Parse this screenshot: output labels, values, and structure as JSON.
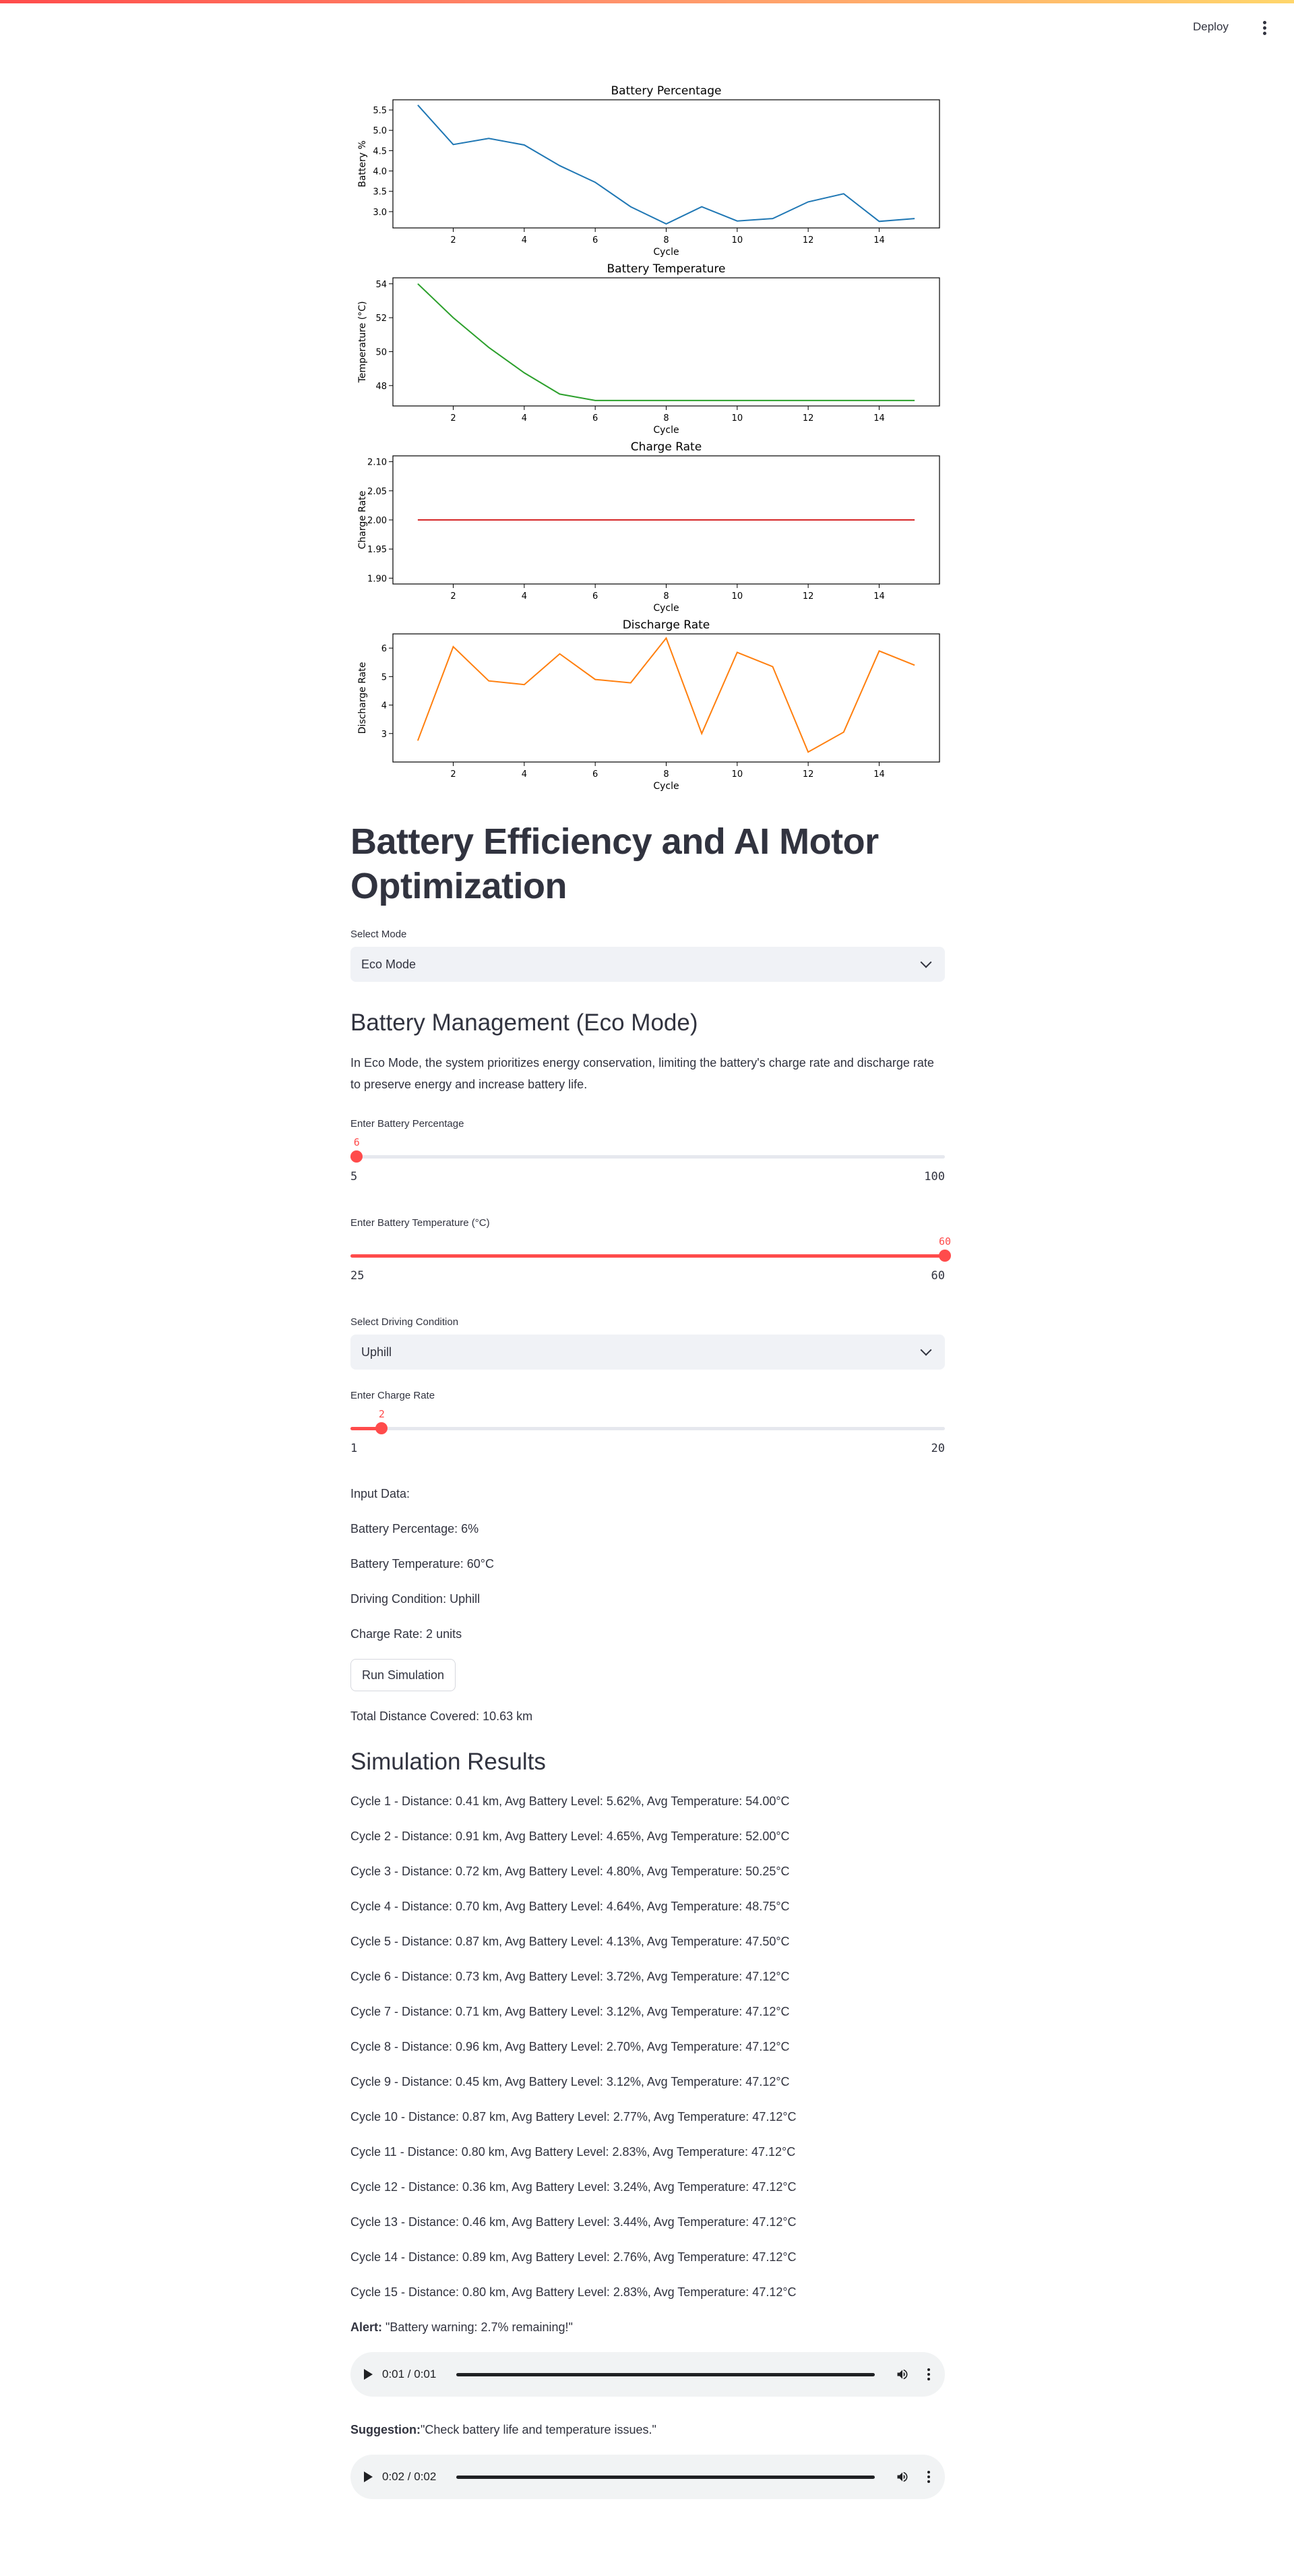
{
  "header": {
    "deploy_label": "Deploy"
  },
  "chart_data": [
    {
      "type": "line",
      "title": "Battery Percentage",
      "xlabel": "Cycle",
      "ylabel": "Battery %",
      "x": [
        1,
        2,
        3,
        4,
        5,
        6,
        7,
        8,
        9,
        10,
        11,
        12,
        13,
        14,
        15
      ],
      "values": [
        5.62,
        4.65,
        4.8,
        4.64,
        4.13,
        3.72,
        3.12,
        2.7,
        3.12,
        2.77,
        2.83,
        3.24,
        3.44,
        2.76,
        2.83
      ],
      "ylim": [
        2.6,
        5.75
      ],
      "yticks": [
        "3.0",
        "3.5",
        "4.0",
        "4.5",
        "5.0",
        "5.5"
      ],
      "xticks": [
        "2",
        "4",
        "6",
        "8",
        "10",
        "12",
        "14"
      ],
      "color": "#1f77b4"
    },
    {
      "type": "line",
      "title": "Battery Temperature",
      "xlabel": "Cycle",
      "ylabel": "Temperature (°C)",
      "x": [
        1,
        2,
        3,
        4,
        5,
        6,
        7,
        8,
        9,
        10,
        11,
        12,
        13,
        14,
        15
      ],
      "values": [
        54.0,
        52.0,
        50.25,
        48.75,
        47.5,
        47.12,
        47.12,
        47.12,
        47.12,
        47.12,
        47.12,
        47.12,
        47.12,
        47.12,
        47.12
      ],
      "ylim": [
        46.8,
        54.35
      ],
      "yticks": [
        "48",
        "50",
        "52",
        "54"
      ],
      "xticks": [
        "2",
        "4",
        "6",
        "8",
        "10",
        "12",
        "14"
      ],
      "color": "#2ca02c"
    },
    {
      "type": "line",
      "title": "Charge Rate",
      "xlabel": "Cycle",
      "ylabel": "Charge Rate",
      "x": [
        1,
        2,
        3,
        4,
        5,
        6,
        7,
        8,
        9,
        10,
        11,
        12,
        13,
        14,
        15
      ],
      "values": [
        2,
        2,
        2,
        2,
        2,
        2,
        2,
        2,
        2,
        2,
        2,
        2,
        2,
        2,
        2
      ],
      "ylim": [
        1.89,
        2.11
      ],
      "yticks": [
        "1.90",
        "1.95",
        "2.00",
        "2.05",
        "2.10"
      ],
      "xticks": [
        "2",
        "4",
        "6",
        "8",
        "10",
        "12",
        "14"
      ],
      "color": "#d62728"
    },
    {
      "type": "line",
      "title": "Discharge Rate",
      "xlabel": "Cycle",
      "ylabel": "Discharge Rate",
      "x": [
        1,
        2,
        3,
        4,
        5,
        6,
        7,
        8,
        9,
        10,
        11,
        12,
        13,
        14,
        15
      ],
      "values": [
        2.75,
        6.05,
        4.85,
        4.72,
        5.8,
        4.9,
        4.78,
        6.35,
        3.0,
        5.85,
        5.35,
        2.35,
        3.05,
        5.9,
        5.4
      ],
      "ylim": [
        2.0,
        6.5
      ],
      "yticks": [
        "3",
        "4",
        "5",
        "6"
      ],
      "xticks": [
        "2",
        "4",
        "6",
        "8",
        "10",
        "12",
        "14"
      ],
      "color": "#ff7f0e"
    }
  ],
  "main": {
    "title": "Battery Efficiency and AI Motor Optimization",
    "mode_label": "Select Mode",
    "mode_value": "Eco Mode",
    "section_title": "Battery Management (Eco Mode)",
    "description": "In Eco Mode, the system prioritizes energy conservation, limiting the battery's charge rate and discharge rate to preserve energy and increase battery life.",
    "sliders": {
      "percentage": {
        "label": "Enter Battery Percentage",
        "value": "6",
        "min": "5",
        "max": "100",
        "fraction": 0.0105
      },
      "temperature": {
        "label": "Enter Battery Temperature (°C)",
        "value": "60",
        "min": "25",
        "max": "60",
        "fraction": 1.0
      },
      "charge": {
        "label": "Enter Charge Rate",
        "value": "2",
        "min": "1",
        "max": "20",
        "fraction": 0.0526
      }
    },
    "condition_label": "Select Driving Condition",
    "condition_value": "Uphill",
    "input_header": "Input Data:",
    "input_lines": [
      "Battery Percentage: 6%",
      "Battery Temperature: 60°C",
      "Driving Condition: Uphill",
      "Charge Rate: 2 units"
    ],
    "run_button": "Run Simulation",
    "total_distance": "Total Distance Covered: 10.63 km",
    "results_title": "Simulation Results",
    "results": [
      "Cycle 1 - Distance: 0.41 km, Avg Battery Level: 5.62%, Avg Temperature: 54.00°C",
      "Cycle 2 - Distance: 0.91 km, Avg Battery Level: 4.65%, Avg Temperature: 52.00°C",
      "Cycle 3 - Distance: 0.72 km, Avg Battery Level: 4.80%, Avg Temperature: 50.25°C",
      "Cycle 4 - Distance: 0.70 km, Avg Battery Level: 4.64%, Avg Temperature: 48.75°C",
      "Cycle 5 - Distance: 0.87 km, Avg Battery Level: 4.13%, Avg Temperature: 47.50°C",
      "Cycle 6 - Distance: 0.73 km, Avg Battery Level: 3.72%, Avg Temperature: 47.12°C",
      "Cycle 7 - Distance: 0.71 km, Avg Battery Level: 3.12%, Avg Temperature: 47.12°C",
      "Cycle 8 - Distance: 0.96 km, Avg Battery Level: 2.70%, Avg Temperature: 47.12°C",
      "Cycle 9 - Distance: 0.45 km, Avg Battery Level: 3.12%, Avg Temperature: 47.12°C",
      "Cycle 10 - Distance: 0.87 km, Avg Battery Level: 2.77%, Avg Temperature: 47.12°C",
      "Cycle 11 - Distance: 0.80 km, Avg Battery Level: 2.83%, Avg Temperature: 47.12°C",
      "Cycle 12 - Distance: 0.36 km, Avg Battery Level: 3.24%, Avg Temperature: 47.12°C",
      "Cycle 13 - Distance: 0.46 km, Avg Battery Level: 3.44%, Avg Temperature: 47.12°C",
      "Cycle 14 - Distance: 0.89 km, Avg Battery Level: 2.76%, Avg Temperature: 47.12°C",
      "Cycle 15 - Distance: 0.80 km, Avg Battery Level: 2.83%, Avg Temperature: 47.12°C"
    ],
    "alert_label": "Alert:",
    "alert_text": " \"Battery warning: 2.7% remaining!\"",
    "audio1_time": "0:01 / 0:01",
    "suggestion_label": "Suggestion:",
    "suggestion_text": "\"Check battery life and temperature issues.\"",
    "audio2_time": "0:02 / 0:02"
  },
  "icons": [
    "menu-icon",
    "chevron-down-icon",
    "play-icon",
    "volume-icon",
    "more-icon"
  ]
}
